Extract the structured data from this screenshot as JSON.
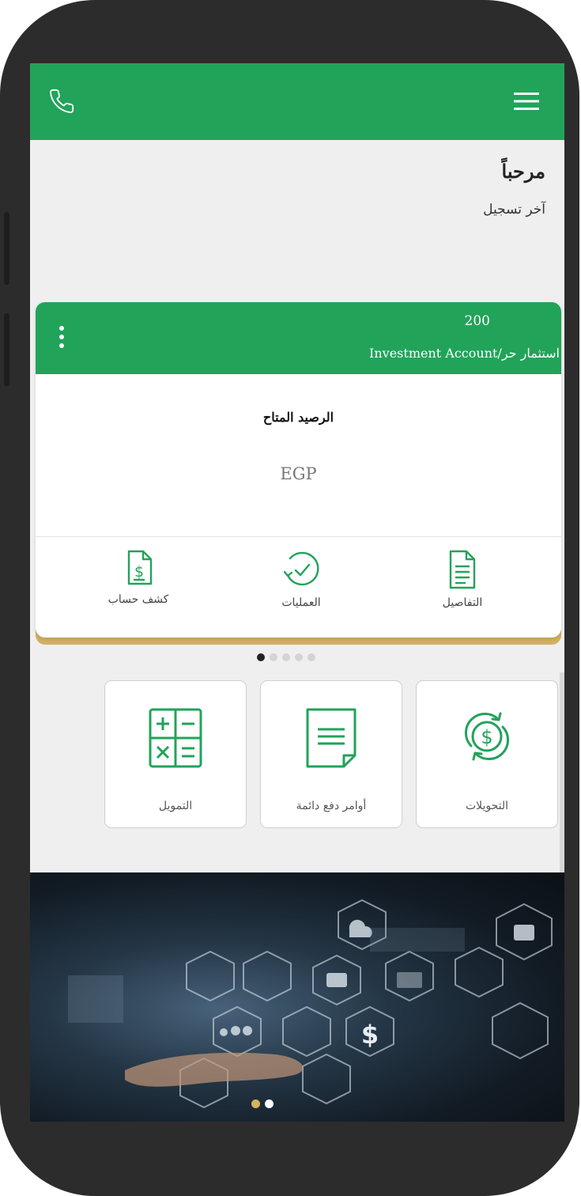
{
  "header": {
    "menu_icon": "hamburger-menu-icon",
    "call_icon": "phone-icon"
  },
  "welcome": {
    "title": "مرحباً",
    "last_login": "آخر تسجيل"
  },
  "account_card": {
    "account_number": "200",
    "account_name": "Investment Account/استثمار حر",
    "balance_label": "الرصيد المتاح",
    "currency": "EGP",
    "actions": [
      {
        "label": "كشف حساب",
        "icon": "statement-dollar-doc-icon"
      },
      {
        "label": "العمليات",
        "icon": "history-clock-icon"
      },
      {
        "label": "التفاصيل",
        "icon": "details-document-icon"
      }
    ]
  },
  "pager": {
    "count": 5,
    "active_index": 0
  },
  "services": [
    {
      "label": "التمويل",
      "icon": "calculator-icon"
    },
    {
      "label": "أوامر دفع دائمة",
      "icon": "standing-order-document-icon"
    },
    {
      "label": "التحويلات",
      "icon": "transfer-dollar-icon"
    }
  ],
  "banner": {
    "slides": 2,
    "active_index": 0
  },
  "colors": {
    "primary": "#22a35a",
    "accent_gold": "#d9b25d",
    "background": "#efefef"
  }
}
